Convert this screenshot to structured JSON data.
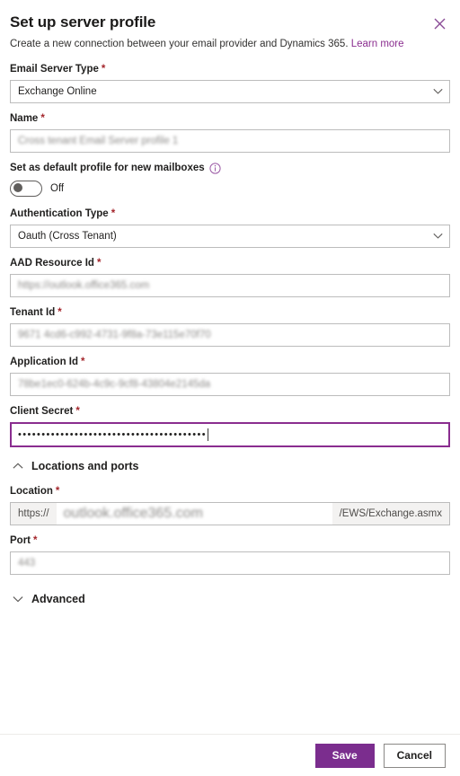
{
  "dialog": {
    "title": "Set up server profile",
    "subtitle": "Create a new connection between your email provider and Dynamics 365.",
    "learn_more": "Learn more",
    "close_icon": "close-icon",
    "accent_color": "#7B2D8E",
    "link_color": "#8A2D8F",
    "required_marker": "*"
  },
  "fields": {
    "email_server_type": {
      "label": "Email Server Type",
      "value": "Exchange Online",
      "icon": "chevron-down-icon"
    },
    "name": {
      "label": "Name",
      "value": "Cross tenant Email Server profile 1"
    },
    "default_profile": {
      "label": "Set as default profile for new mailboxes",
      "info_icon": "info-icon",
      "state": "Off"
    },
    "authentication_type": {
      "label": "Authentication Type",
      "value": "Oauth (Cross Tenant)",
      "icon": "chevron-down-icon"
    },
    "aad_resource_id": {
      "label": "AAD Resource Id",
      "value": "https://outlook.office365.com"
    },
    "tenant_id": {
      "label": "Tenant Id",
      "value": "9671 4cd6-c992-4731-9f8a-73e115e70f70"
    },
    "application_id": {
      "label": "Application Id",
      "value": "78be1ec0-624b-4c9c-9cf8-43804e2145da"
    },
    "client_secret": {
      "label": "Client Secret",
      "value": "••••••••••••••••••••••••••••••••••••••••",
      "focused": true
    },
    "location": {
      "label": "Location",
      "prefix": "https://",
      "value": "outlook.office365.com",
      "suffix": "/EWS/Exchange.asmx"
    },
    "port": {
      "label": "Port",
      "value": "443"
    }
  },
  "sections": {
    "locations_and_ports": {
      "label": "Locations and ports",
      "icon": "chevron-up-icon",
      "expanded": "true"
    },
    "advanced": {
      "label": "Advanced",
      "icon": "chevron-down-icon",
      "expanded": "false"
    }
  },
  "footer": {
    "save_label": "Save",
    "cancel_label": "Cancel"
  }
}
